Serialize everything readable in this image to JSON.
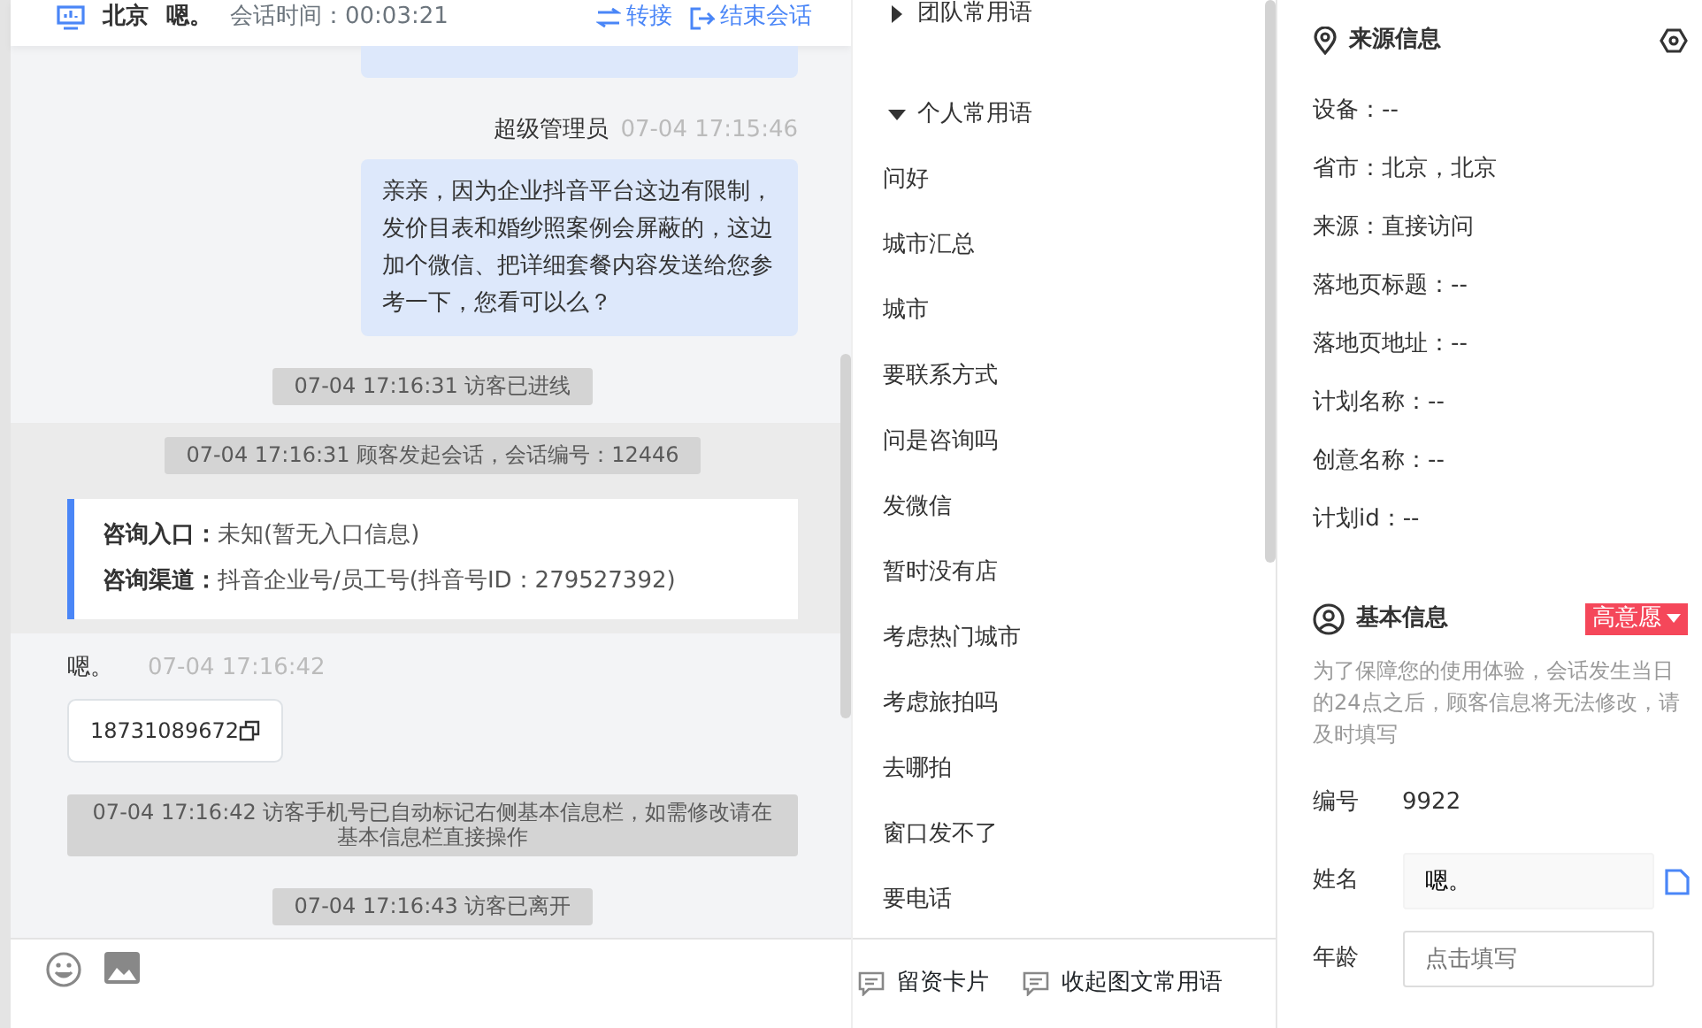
{
  "header": {
    "location": "北京",
    "visitor": "嗯。",
    "duration": "会话时间：00:03:21",
    "actions": [
      {
        "label": "转接",
        "kind": "transfer"
      },
      {
        "label": "结束会话",
        "kind": "end"
      }
    ]
  },
  "messages": [
    {
      "kind": "bubble-stub"
    },
    {
      "kind": "agent",
      "sender": "超级管理员",
      "time": "07-04 17:15:46",
      "text": "亲亲，因为企业抖音平台这边有限制，发价目表和婚纱照案例会屏蔽的，这边加个微信、把详细套餐内容发送给您参考一下，您看可以么？"
    },
    {
      "kind": "system",
      "text": "07-04 17:16:31 访客已进线"
    },
    {
      "kind": "session",
      "text": "07-04 17:16:31 顾客发起会话，会话编号：12446",
      "rows": [
        {
          "label": "咨询入口：",
          "value": "未知(暂无入口信息)"
        },
        {
          "label": "咨询渠道：",
          "value": "抖音企业号/员工号(抖音号ID：279527392)"
        }
      ]
    },
    {
      "kind": "visitor",
      "sender": "嗯。",
      "time": "07-04 17:16:42",
      "phone": "18731089672"
    },
    {
      "kind": "system",
      "text": "07-04 17:16:42 访客手机号已自动标记右侧基本信息栏，如需修改请在基本信息栏直接操作"
    },
    {
      "kind": "system",
      "text": "07-04 17:16:43 访客已离开"
    }
  ],
  "phrases": {
    "groups": [
      {
        "title": "团队常用语",
        "expanded": false
      },
      {
        "title": "个人常用语",
        "expanded": true,
        "items": [
          "问好",
          "城市汇总",
          "城市",
          "要联系方式",
          "问是咨询吗",
          "发微信",
          "暂时没有店",
          "考虑热门城市",
          "考虑旅拍吗",
          "去哪拍",
          "窗口发不了",
          "要电话"
        ]
      }
    ],
    "actions": [
      "留资卡片",
      "收起图文常用语"
    ]
  },
  "source": {
    "title": "来源信息",
    "fields": [
      "设备：--",
      "省市：北京，北京",
      "来源：直接访问",
      "落地页标题：--",
      "落地页地址：--",
      "计划名称：--",
      "创意名称：--",
      "计划id：--"
    ]
  },
  "basic": {
    "title": "基本信息",
    "tag": "高意愿",
    "note": "为了保障您的使用体验，会话发生当日的24点之后，顾客信息将无法修改，请及时填写",
    "fields": [
      {
        "kind": "text",
        "label": "编号",
        "value": "9922"
      },
      {
        "kind": "input",
        "label": "姓名",
        "value": "嗯。",
        "copy": true
      },
      {
        "kind": "input",
        "label": "年龄",
        "placeholder": "点击填写"
      }
    ]
  }
}
